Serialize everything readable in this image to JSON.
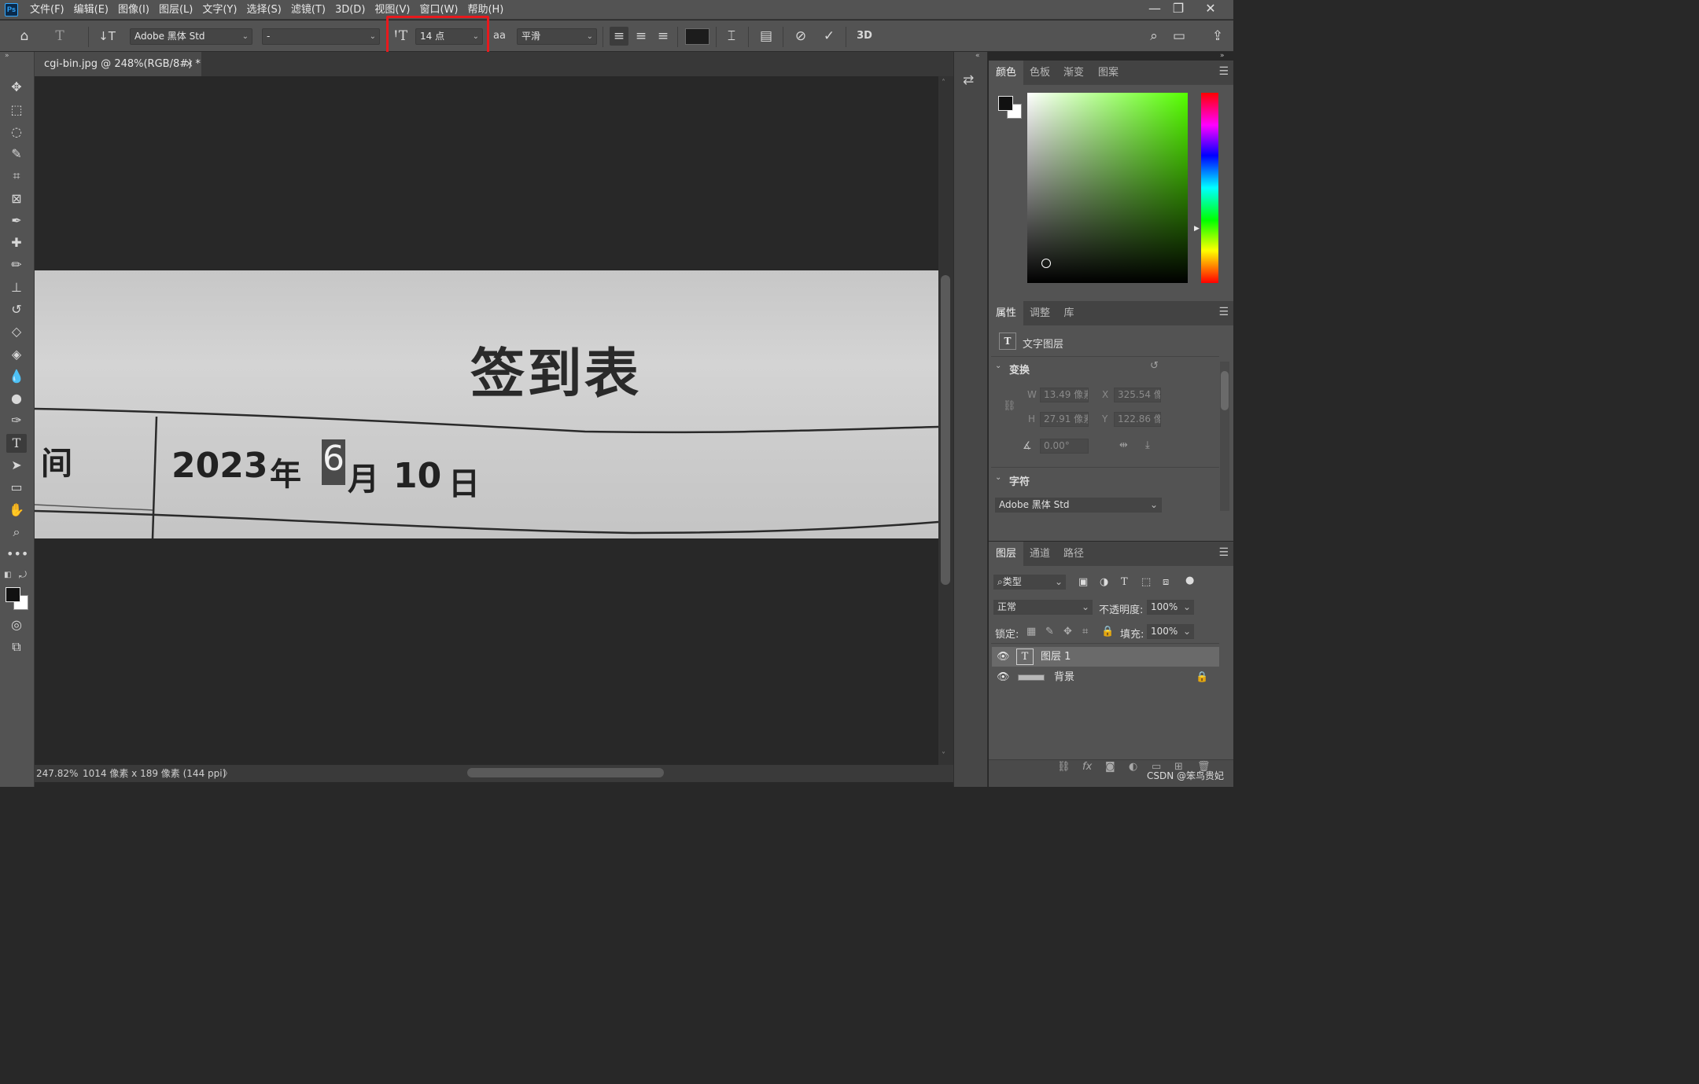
{
  "app": {
    "logo": "Ps"
  },
  "menu": [
    "文件(F)",
    "编辑(E)",
    "图像(I)",
    "图层(L)",
    "文字(Y)",
    "选择(S)",
    "滤镜(T)",
    "3D(D)",
    "视图(V)",
    "窗口(W)",
    "帮助(H)"
  ],
  "window_controls": {
    "minimize": "—",
    "restore": "❐",
    "close": "✕"
  },
  "options": {
    "font_family": "Adobe 黑体 Std",
    "font_style": "-",
    "font_size": "14 点",
    "antialias": "平滑",
    "threed_label": "3D",
    "text_color": "#1c1c1c"
  },
  "document": {
    "tab_title": "cgi-bin.jpg @ 248%(RGB/8#) *",
    "tab_close": "×",
    "zoom": "247.82%",
    "info": "1014 像素 x 189 像素 (144 ppi)",
    "info_arrow": "〉"
  },
  "photo_content": {
    "title": "签到表",
    "row_label": "间",
    "year": "2023",
    "year_char": "年",
    "month_editing": "6",
    "month_char": "月",
    "day": "10",
    "day_char": "日"
  },
  "color_panel": {
    "tabs": [
      "颜色",
      "色板",
      "渐变",
      "图案"
    ],
    "foreground": "#111111",
    "background": "#ffffff",
    "hue_color": "#55ff00"
  },
  "properties_panel": {
    "tabs": [
      "属性",
      "调整",
      "库"
    ],
    "layer_type": "文字图层",
    "transform_title": "变换",
    "w_label": "W",
    "w_value": "13.49 像素",
    "h_label": "H",
    "h_value": "27.91 像素",
    "x_label": "X",
    "x_value": "325.54 像素",
    "y_label": "Y",
    "y_value": "122.86 像素",
    "angle_value": "0.00°",
    "character_title": "字符",
    "character_font": "Adobe 黑体 Std"
  },
  "layers_panel": {
    "tabs": [
      "图层",
      "通道",
      "路径"
    ],
    "filter_label": "类型",
    "blend_mode": "正常",
    "opacity_label": "不透明度:",
    "opacity_value": "100%",
    "lock_label": "锁定:",
    "fill_label": "填充:",
    "fill_value": "100%",
    "layers": [
      {
        "name": "图层 1",
        "type": "text",
        "selected": true
      },
      {
        "name": "背景",
        "type": "image",
        "locked": true
      }
    ]
  },
  "watermark": "CSDN @笨鸟贵妃"
}
